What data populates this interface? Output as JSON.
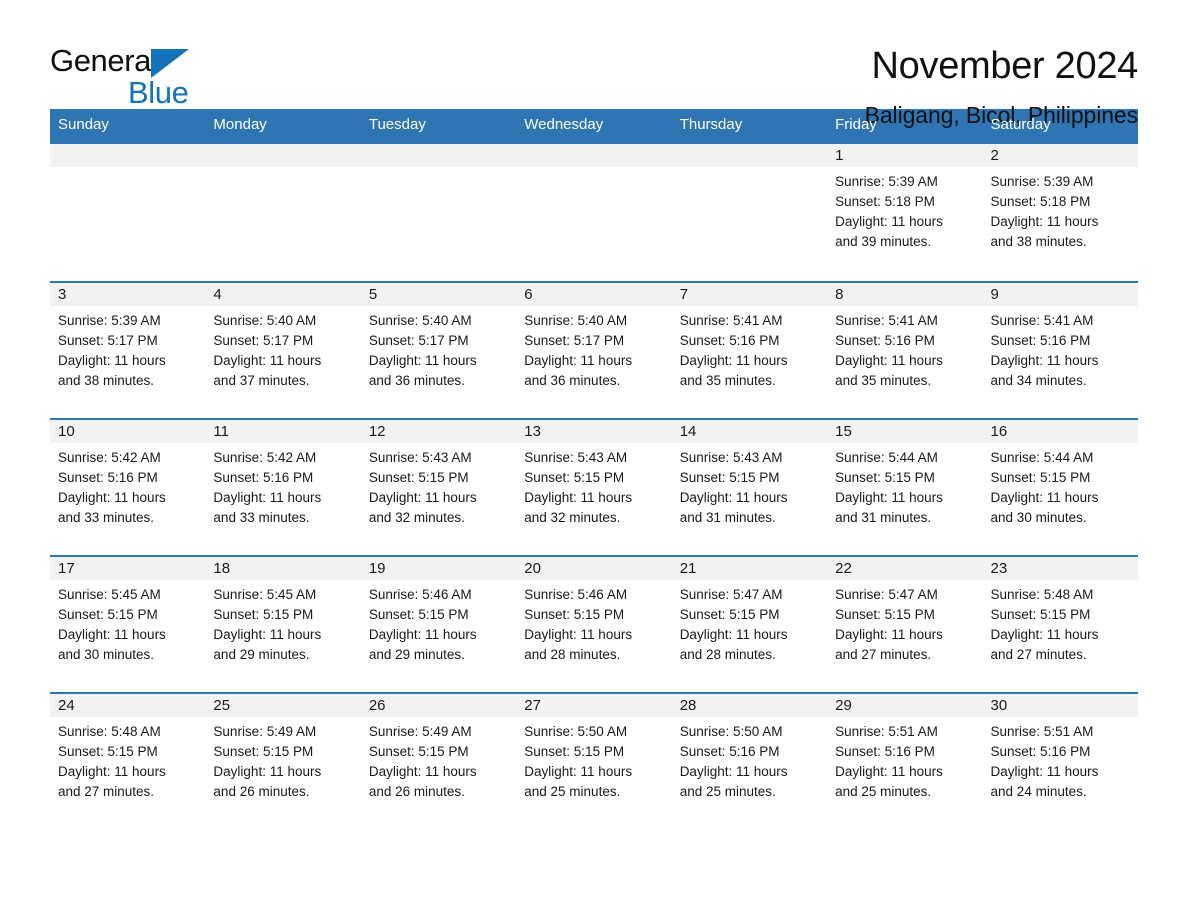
{
  "brand": {
    "name_part1": "General",
    "name_part2": "Blue",
    "accent_color": "#1272bb",
    "triangle_icon": "triangle-icon"
  },
  "header": {
    "month_title": "November 2024",
    "location": "Baligang, Bicol, Philippines",
    "header_bg": "#2f74b3"
  },
  "weekday_headers": [
    "Sunday",
    "Monday",
    "Tuesday",
    "Wednesday",
    "Thursday",
    "Friday",
    "Saturday"
  ],
  "weeks": [
    [
      {
        "day": "",
        "sunrise": "",
        "sunset": "",
        "daylight1": "",
        "daylight2": ""
      },
      {
        "day": "",
        "sunrise": "",
        "sunset": "",
        "daylight1": "",
        "daylight2": ""
      },
      {
        "day": "",
        "sunrise": "",
        "sunset": "",
        "daylight1": "",
        "daylight2": ""
      },
      {
        "day": "",
        "sunrise": "",
        "sunset": "",
        "daylight1": "",
        "daylight2": ""
      },
      {
        "day": "",
        "sunrise": "",
        "sunset": "",
        "daylight1": "",
        "daylight2": ""
      },
      {
        "day": "1",
        "sunrise": "Sunrise: 5:39 AM",
        "sunset": "Sunset: 5:18 PM",
        "daylight1": "Daylight: 11 hours",
        "daylight2": "and 39 minutes."
      },
      {
        "day": "2",
        "sunrise": "Sunrise: 5:39 AM",
        "sunset": "Sunset: 5:18 PM",
        "daylight1": "Daylight: 11 hours",
        "daylight2": "and 38 minutes."
      }
    ],
    [
      {
        "day": "3",
        "sunrise": "Sunrise: 5:39 AM",
        "sunset": "Sunset: 5:17 PM",
        "daylight1": "Daylight: 11 hours",
        "daylight2": "and 38 minutes."
      },
      {
        "day": "4",
        "sunrise": "Sunrise: 5:40 AM",
        "sunset": "Sunset: 5:17 PM",
        "daylight1": "Daylight: 11 hours",
        "daylight2": "and 37 minutes."
      },
      {
        "day": "5",
        "sunrise": "Sunrise: 5:40 AM",
        "sunset": "Sunset: 5:17 PM",
        "daylight1": "Daylight: 11 hours",
        "daylight2": "and 36 minutes."
      },
      {
        "day": "6",
        "sunrise": "Sunrise: 5:40 AM",
        "sunset": "Sunset: 5:17 PM",
        "daylight1": "Daylight: 11 hours",
        "daylight2": "and 36 minutes."
      },
      {
        "day": "7",
        "sunrise": "Sunrise: 5:41 AM",
        "sunset": "Sunset: 5:16 PM",
        "daylight1": "Daylight: 11 hours",
        "daylight2": "and 35 minutes."
      },
      {
        "day": "8",
        "sunrise": "Sunrise: 5:41 AM",
        "sunset": "Sunset: 5:16 PM",
        "daylight1": "Daylight: 11 hours",
        "daylight2": "and 35 minutes."
      },
      {
        "day": "9",
        "sunrise": "Sunrise: 5:41 AM",
        "sunset": "Sunset: 5:16 PM",
        "daylight1": "Daylight: 11 hours",
        "daylight2": "and 34 minutes."
      }
    ],
    [
      {
        "day": "10",
        "sunrise": "Sunrise: 5:42 AM",
        "sunset": "Sunset: 5:16 PM",
        "daylight1": "Daylight: 11 hours",
        "daylight2": "and 33 minutes."
      },
      {
        "day": "11",
        "sunrise": "Sunrise: 5:42 AM",
        "sunset": "Sunset: 5:16 PM",
        "daylight1": "Daylight: 11 hours",
        "daylight2": "and 33 minutes."
      },
      {
        "day": "12",
        "sunrise": "Sunrise: 5:43 AM",
        "sunset": "Sunset: 5:15 PM",
        "daylight1": "Daylight: 11 hours",
        "daylight2": "and 32 minutes."
      },
      {
        "day": "13",
        "sunrise": "Sunrise: 5:43 AM",
        "sunset": "Sunset: 5:15 PM",
        "daylight1": "Daylight: 11 hours",
        "daylight2": "and 32 minutes."
      },
      {
        "day": "14",
        "sunrise": "Sunrise: 5:43 AM",
        "sunset": "Sunset: 5:15 PM",
        "daylight1": "Daylight: 11 hours",
        "daylight2": "and 31 minutes."
      },
      {
        "day": "15",
        "sunrise": "Sunrise: 5:44 AM",
        "sunset": "Sunset: 5:15 PM",
        "daylight1": "Daylight: 11 hours",
        "daylight2": "and 31 minutes."
      },
      {
        "day": "16",
        "sunrise": "Sunrise: 5:44 AM",
        "sunset": "Sunset: 5:15 PM",
        "daylight1": "Daylight: 11 hours",
        "daylight2": "and 30 minutes."
      }
    ],
    [
      {
        "day": "17",
        "sunrise": "Sunrise: 5:45 AM",
        "sunset": "Sunset: 5:15 PM",
        "daylight1": "Daylight: 11 hours",
        "daylight2": "and 30 minutes."
      },
      {
        "day": "18",
        "sunrise": "Sunrise: 5:45 AM",
        "sunset": "Sunset: 5:15 PM",
        "daylight1": "Daylight: 11 hours",
        "daylight2": "and 29 minutes."
      },
      {
        "day": "19",
        "sunrise": "Sunrise: 5:46 AM",
        "sunset": "Sunset: 5:15 PM",
        "daylight1": "Daylight: 11 hours",
        "daylight2": "and 29 minutes."
      },
      {
        "day": "20",
        "sunrise": "Sunrise: 5:46 AM",
        "sunset": "Sunset: 5:15 PM",
        "daylight1": "Daylight: 11 hours",
        "daylight2": "and 28 minutes."
      },
      {
        "day": "21",
        "sunrise": "Sunrise: 5:47 AM",
        "sunset": "Sunset: 5:15 PM",
        "daylight1": "Daylight: 11 hours",
        "daylight2": "and 28 minutes."
      },
      {
        "day": "22",
        "sunrise": "Sunrise: 5:47 AM",
        "sunset": "Sunset: 5:15 PM",
        "daylight1": "Daylight: 11 hours",
        "daylight2": "and 27 minutes."
      },
      {
        "day": "23",
        "sunrise": "Sunrise: 5:48 AM",
        "sunset": "Sunset: 5:15 PM",
        "daylight1": "Daylight: 11 hours",
        "daylight2": "and 27 minutes."
      }
    ],
    [
      {
        "day": "24",
        "sunrise": "Sunrise: 5:48 AM",
        "sunset": "Sunset: 5:15 PM",
        "daylight1": "Daylight: 11 hours",
        "daylight2": "and 27 minutes."
      },
      {
        "day": "25",
        "sunrise": "Sunrise: 5:49 AM",
        "sunset": "Sunset: 5:15 PM",
        "daylight1": "Daylight: 11 hours",
        "daylight2": "and 26 minutes."
      },
      {
        "day": "26",
        "sunrise": "Sunrise: 5:49 AM",
        "sunset": "Sunset: 5:15 PM",
        "daylight1": "Daylight: 11 hours",
        "daylight2": "and 26 minutes."
      },
      {
        "day": "27",
        "sunrise": "Sunrise: 5:50 AM",
        "sunset": "Sunset: 5:15 PM",
        "daylight1": "Daylight: 11 hours",
        "daylight2": "and 25 minutes."
      },
      {
        "day": "28",
        "sunrise": "Sunrise: 5:50 AM",
        "sunset": "Sunset: 5:16 PM",
        "daylight1": "Daylight: 11 hours",
        "daylight2": "and 25 minutes."
      },
      {
        "day": "29",
        "sunrise": "Sunrise: 5:51 AM",
        "sunset": "Sunset: 5:16 PM",
        "daylight1": "Daylight: 11 hours",
        "daylight2": "and 25 minutes."
      },
      {
        "day": "30",
        "sunrise": "Sunrise: 5:51 AM",
        "sunset": "Sunset: 5:16 PM",
        "daylight1": "Daylight: 11 hours",
        "daylight2": "and 24 minutes."
      }
    ]
  ]
}
